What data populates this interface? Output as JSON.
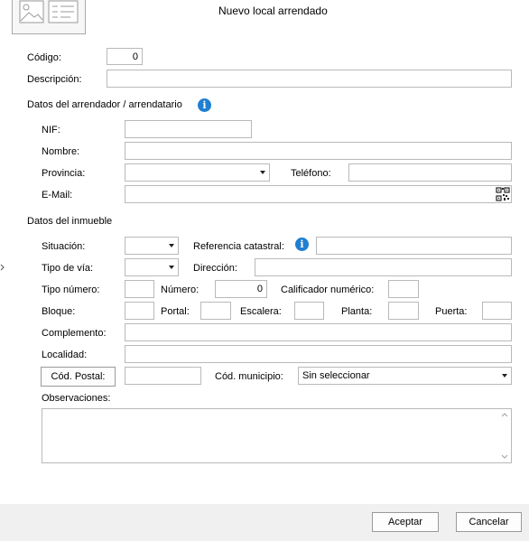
{
  "title": "Nuevo local arrendado",
  "icons": {
    "image": "image-placeholder-icon",
    "info": "info-icon",
    "qr": "qr-code-icon",
    "dropdown": "chevron-down-icon",
    "side_arrow": "chevron-right-icon",
    "info_glyph": "i"
  },
  "general": {
    "codigo_label": "Código:",
    "codigo_value": "0",
    "descripcion_label": "Descripción:",
    "descripcion_value": ""
  },
  "arrendador": {
    "section_title": "Datos del arrendador / arrendatario",
    "nif_label": "NIF:",
    "nif_value": "",
    "nombre_label": "Nombre:",
    "nombre_value": "",
    "provincia_label": "Provincia:",
    "provincia_value": "",
    "telefono_label": "Teléfono:",
    "telefono_value": "",
    "email_label": "E-Mail:",
    "email_value": ""
  },
  "inmueble": {
    "section_title": "Datos del inmueble",
    "situacion_label": "Situación:",
    "situacion_value": "",
    "ref_catastral_label": "Referencia catastral:",
    "ref_catastral_value": "",
    "tipo_via_label": "Tipo de vía:",
    "tipo_via_value": "",
    "direccion_label": "Dirección:",
    "direccion_value": "",
    "tipo_numero_label": "Tipo número:",
    "tipo_numero_value": "",
    "numero_label": "Número:",
    "numero_value": "0",
    "calificador_label": "Calificador numérico:",
    "calificador_value": "",
    "bloque_label": "Bloque:",
    "bloque_value": "",
    "portal_label": "Portal:",
    "portal_value": "",
    "escalera_label": "Escalera:",
    "escalera_value": "",
    "planta_label": "Planta:",
    "planta_value": "",
    "puerta_label": "Puerta:",
    "puerta_value": "",
    "complemento_label": "Complemento:",
    "complemento_value": "",
    "localidad_label": "Localidad:",
    "localidad_value": "",
    "cod_postal_button": "Cód. Postal:",
    "cod_postal_value": "",
    "cod_municipio_label": "Cód. municipio:",
    "cod_municipio_value": "Sin seleccionar",
    "observaciones_label": "Observaciones:",
    "observaciones_value": ""
  },
  "footer": {
    "accept_label": "Aceptar",
    "cancel_label": "Cancelar"
  }
}
